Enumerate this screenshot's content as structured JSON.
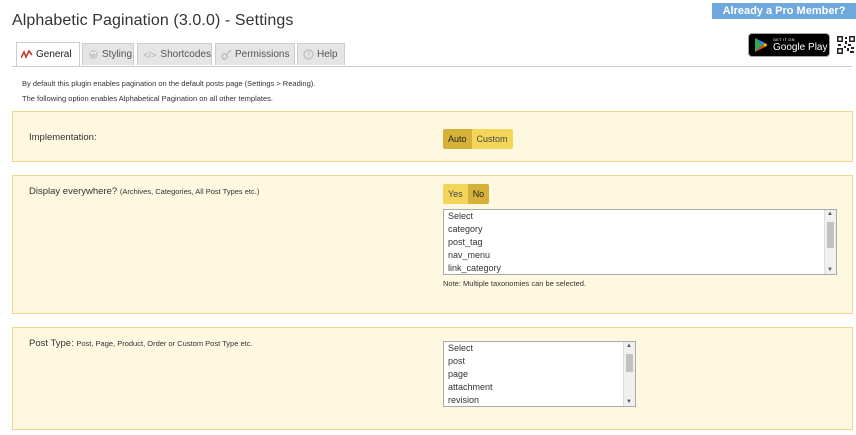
{
  "header": {
    "title": "Alphabetic Pagination (3.0.0) - Settings",
    "pro_banner": "Already a Pro Member?",
    "gplay_small": "GET IT ON",
    "gplay_big": "Google Play"
  },
  "tabs": [
    {
      "label": "General",
      "icon": "logo-icon"
    },
    {
      "label": "Styling",
      "icon": "palette-icon"
    },
    {
      "label": "Shortcodes",
      "icon": "code-icon"
    },
    {
      "label": "Permissions",
      "icon": "key-icon"
    },
    {
      "label": "Help",
      "icon": "help-icon"
    }
  ],
  "intro": {
    "line1": "By default this plugin enables pagination on the default posts page (Settings > Reading).",
    "line2": "The following option enables Alphabetical Pagination on all other templates."
  },
  "implementation": {
    "label": "Implementation:",
    "options": [
      "Auto",
      "Custom"
    ],
    "selected": "Auto"
  },
  "display_everywhere": {
    "label": "Display everywhere?",
    "sub": "(Archives, Categories, All Post Types etc.)",
    "options": [
      "Yes",
      "No"
    ],
    "selected": "No",
    "taxonomies": [
      "Select",
      "category",
      "post_tag",
      "nav_menu",
      "link_category"
    ],
    "note": "Note: Multiple taxonomies can be selected."
  },
  "post_type": {
    "label": "Post Type:",
    "sub": "Post, Page, Product, Order or Custom Post Type etc.",
    "types": [
      "Select",
      "post",
      "page",
      "attachment",
      "revision"
    ]
  },
  "colors": {
    "panel_bg": "#fff8e0",
    "panel_border": "#f0d68a",
    "toggle_bg": "#f3d55a",
    "toggle_on": "#d6b13a",
    "pro_banner": "#6fa8dc"
  }
}
